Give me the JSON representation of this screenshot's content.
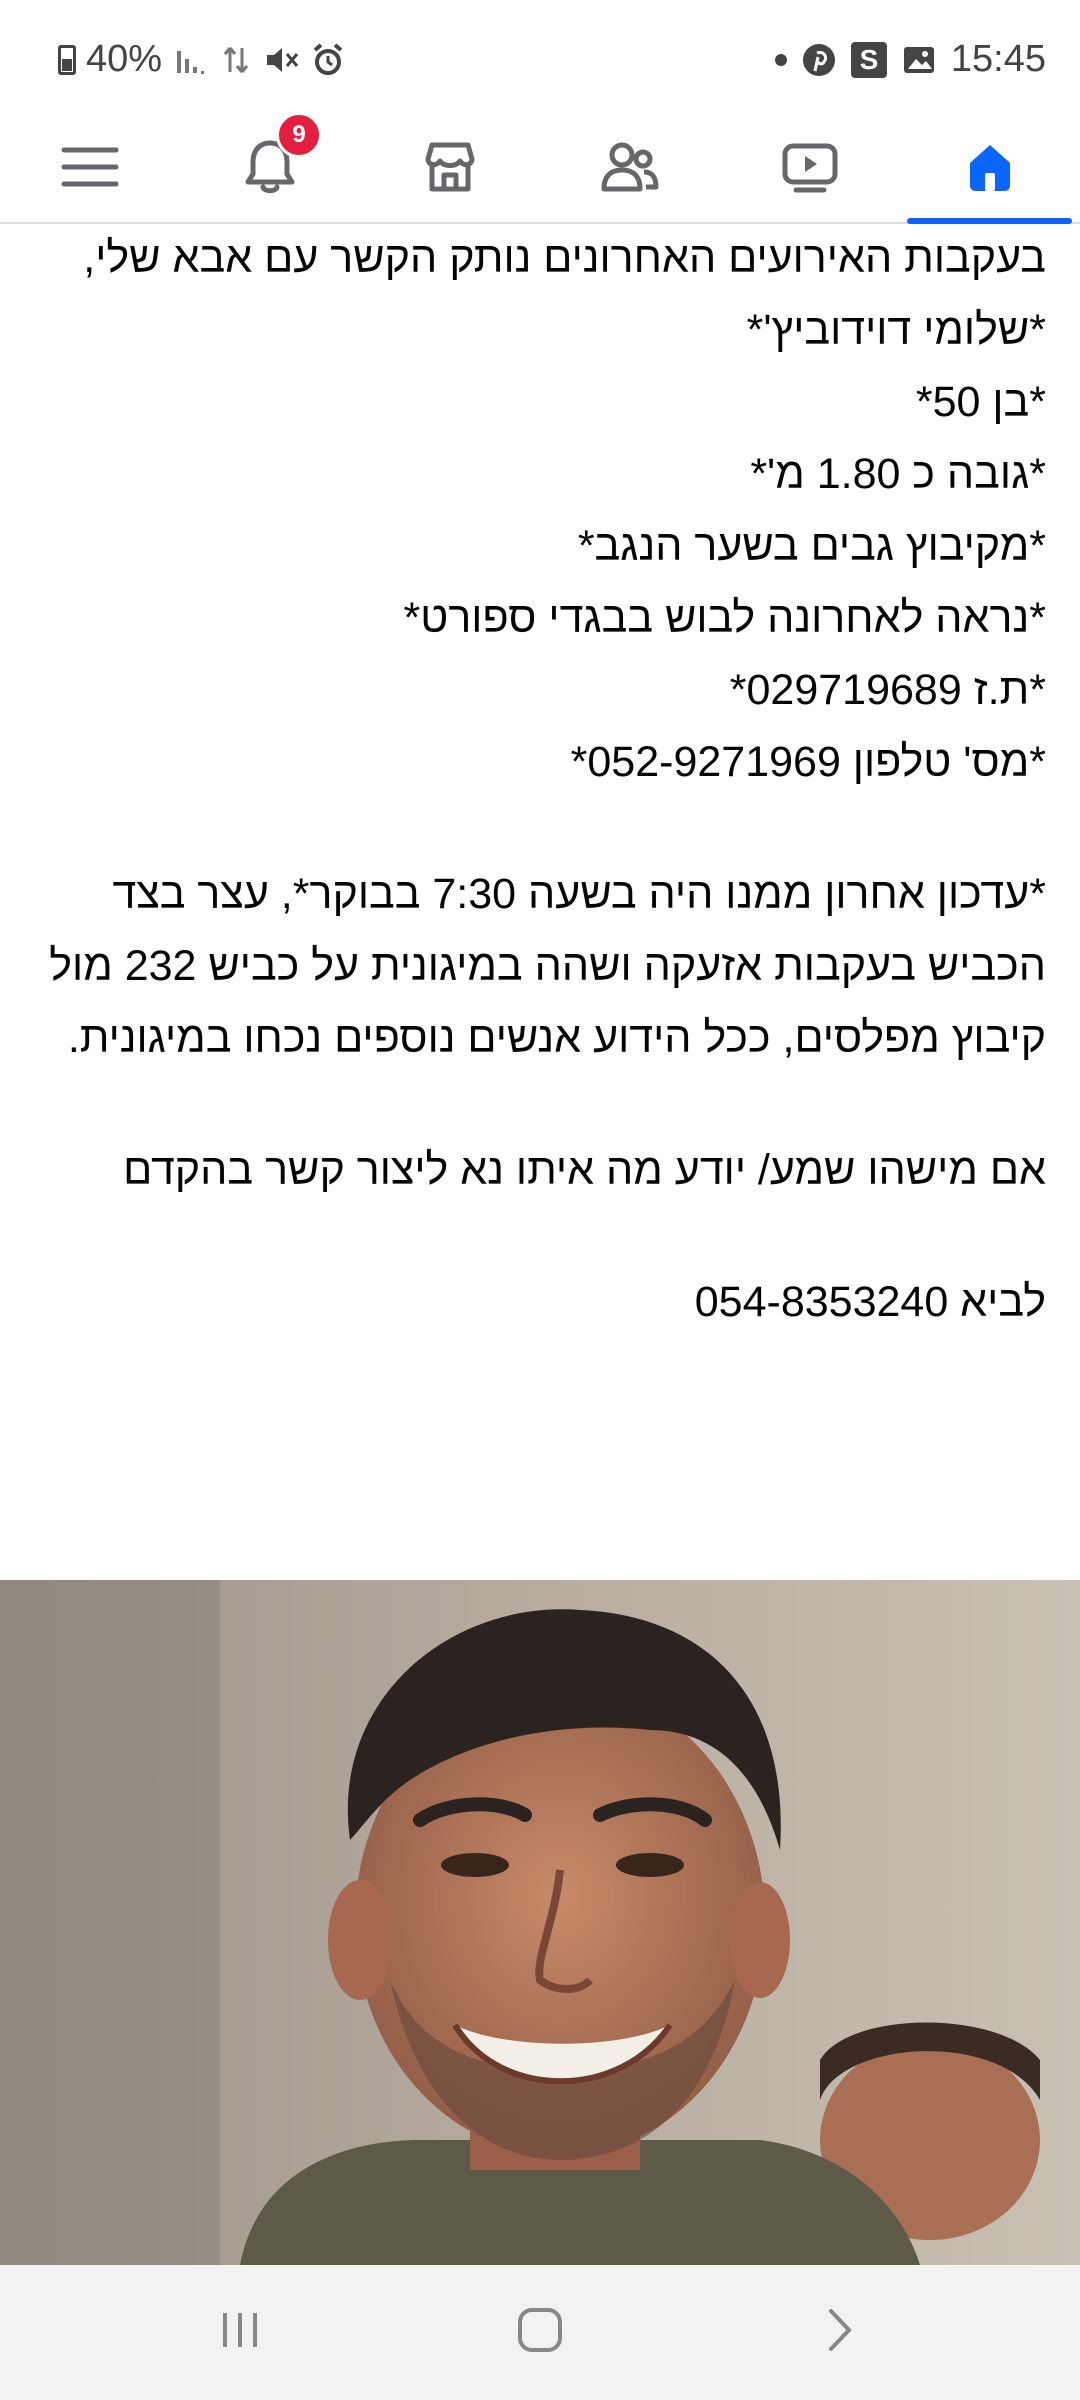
{
  "status_bar": {
    "battery": "40%",
    "time": "15:45",
    "badge_letter": "S",
    "left_icons": [
      "signal-icon",
      "data-arrows-icon",
      "mute-icon",
      "alarm-icon"
    ],
    "right_icons": [
      "notification-dot-icon",
      "pinterest-icon",
      "s-app-icon",
      "gallery-icon"
    ]
  },
  "nav": {
    "notification_count": "9",
    "active_tab": "home",
    "accent_color": "#0866ff",
    "items": [
      "menu-icon",
      "bell-icon",
      "marketplace-icon",
      "friends-icon",
      "video-icon",
      "home-icon"
    ]
  },
  "post": {
    "lines": [
      "בעקבות האירועים האחרונים נותק הקשר עם אבא שלי,",
      "*שלומי דוידוביץ'*",
      "*בן 50*",
      "*גובה כ 1.80 מ'*",
      "*מקיבוץ גבים בשער הנגב*",
      "*נראה לאחרונה לבוש בבגדי ספורט*",
      "*ת.ז 029719689*",
      "*מס' טלפון 052-9271969*"
    ],
    "update_paragraph": "*עדכון אחרון ממנו היה בשעה 7:30 בבוקר*, עצר בצד הכביש בעקבות אזעקה ושהה במיגונית על כביש 232 מול קיבוץ מפלסים, ככל הידוע אנשים נוספים נכחו במיגונית.",
    "request_paragraph": "אם מישהו שמע/ יודע מה איתו נא ליצור קשר בהקדם",
    "contact_line": "לביא 054-8353240"
  }
}
